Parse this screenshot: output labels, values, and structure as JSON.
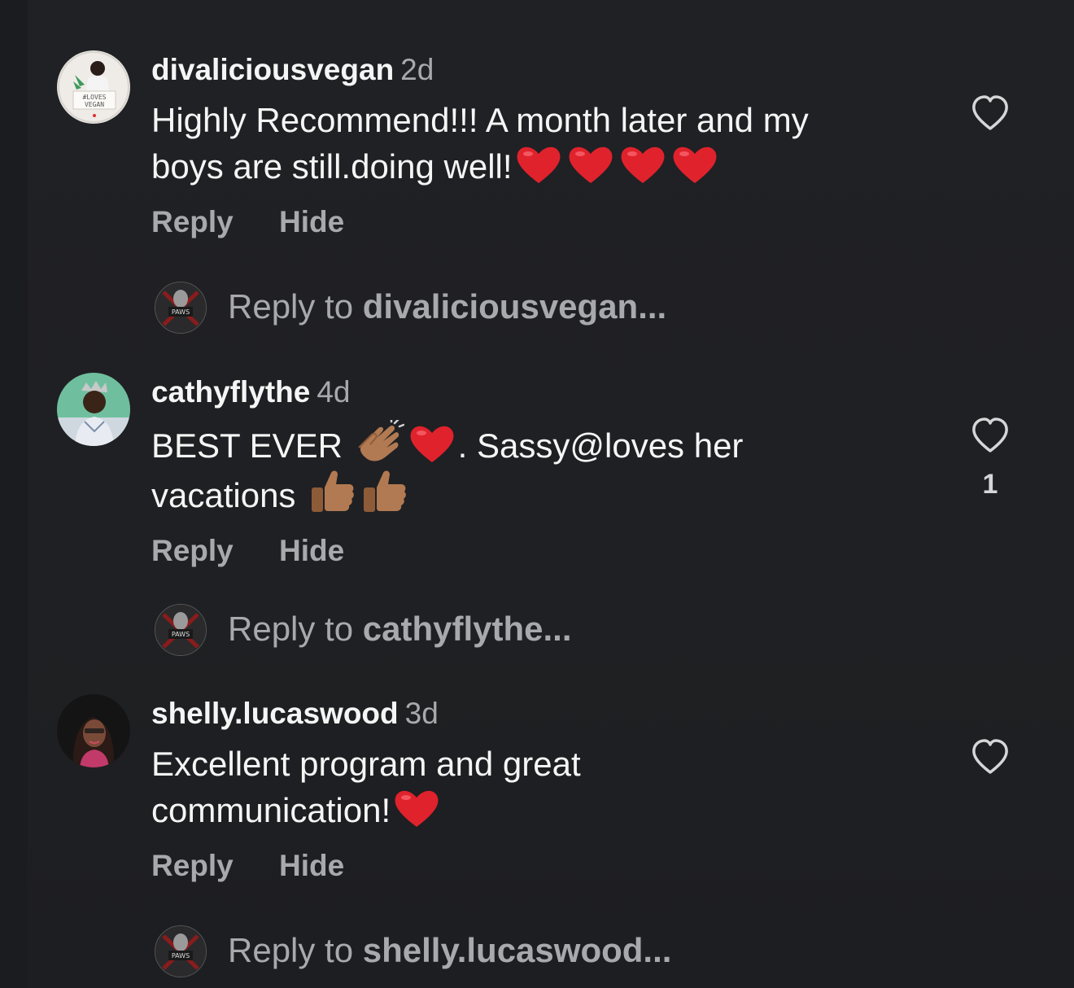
{
  "comments": [
    {
      "username": "divaliciousvegan",
      "time": "2d",
      "text_line1": "Highly Recommend!!! A month later and my",
      "text_line2": "boys are still.doing well!",
      "emojis": [
        "red-heart",
        "red-heart",
        "red-heart",
        "red-heart"
      ],
      "actions": {
        "reply": "Reply",
        "hide": "Hide"
      },
      "likes": "",
      "reply_prompt": {
        "prefix": "Reply to ",
        "target": "divaliciousvegan..."
      },
      "avatar_text": [
        "#LOVES",
        "VEGAN"
      ]
    },
    {
      "username": "cathyflythe",
      "time": "4d",
      "text_part1": "BEST EVER ",
      "text_part2": ". Sassy@loves her",
      "text_line2": "vacations ",
      "emojis": [
        "clapping-hands",
        "red-heart",
        "thumbs-up",
        "thumbs-up"
      ],
      "actions": {
        "reply": "Reply",
        "hide": "Hide"
      },
      "likes": "1",
      "reply_prompt": {
        "prefix": "Reply to ",
        "target": "cathyflythe..."
      }
    },
    {
      "username": "shelly.lucaswood",
      "time": "3d",
      "text_line1": "Excellent program and great",
      "text_line2": "communication!",
      "emojis": [
        "red-heart"
      ],
      "actions": {
        "reply": "Reply",
        "hide": "Hide"
      },
      "likes": "",
      "reply_prompt": {
        "prefix": "Reply to ",
        "target": "shelly.lucaswood..."
      }
    }
  ],
  "reply_avatar_label": "PAWS",
  "colors": {
    "background": "#1f2023",
    "text": "#f5f5f5",
    "secondary_text": "#a8a9ad",
    "heart": "#e0222d"
  }
}
